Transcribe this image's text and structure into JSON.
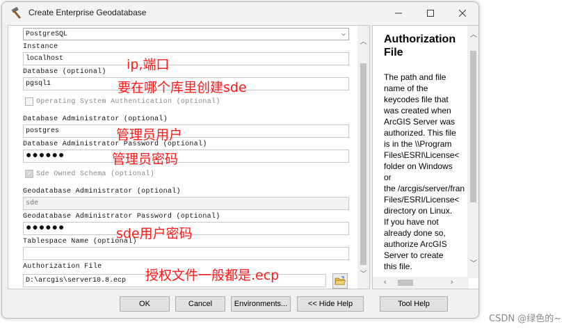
{
  "window": {
    "title": "Create Enterprise Geodatabase"
  },
  "form": {
    "platform_value": "PostgreSQL",
    "instance_label": "Instance",
    "instance_value": "localhost",
    "database_label": "Database (optional)",
    "database_value": "pgsql1",
    "os_auth_label": "Operating System Authentication (optional)",
    "db_admin_label": "Database Administrator (optional)",
    "db_admin_value": "postgres",
    "db_admin_pw_label": "Database Administrator Password (optional)",
    "db_admin_pw_value": "●●●●●●",
    "sde_schema_label": "Sde Owned Schema (optional)",
    "gdb_admin_label": "Geodatabase Administrator (optional)",
    "gdb_admin_value": "sde",
    "gdb_admin_pw_label": "Geodatabase Administrator Password (optional)",
    "gdb_admin_pw_value": "●●●●●●",
    "tablespace_label": "Tablespace Name (optional)",
    "tablespace_value": "",
    "auth_file_label": "Authorization File",
    "auth_file_value": "D:\\arcgis\\server10.8.ecp"
  },
  "annotations": {
    "instance": "ip,端口",
    "database": "要在哪个库里创建sde",
    "db_admin": "管理员用户",
    "db_admin_pw": "管理员密码",
    "gdb_admin_pw": "sde用户密码",
    "auth_file": "授权文件一般都是.ecp"
  },
  "help": {
    "title": "Authorization File",
    "body": "The path and file\nname of the\nkeycodes file that\nwas created when\nArcGIS Server was\nauthorized. This file\nis in the \\\\Program\nFiles\\ESRI\\License<\nfolder on Windows\nor\nthe /arcgis/server/fran\nFiles/ESRI/License<\ndirectory on Linux.\nIf you have not\nalready done so,\nauthorize ArcGIS\nServer to create\nthis file."
  },
  "buttons": {
    "ok": "OK",
    "cancel": "Cancel",
    "environments": "Environments...",
    "hide_help": "<< Hide Help",
    "tool_help": "Tool Help"
  },
  "watermark": "CSDN @绿色的~",
  "icons": {
    "app": "hammer-icon",
    "folder": "open-folder-icon"
  },
  "colors": {
    "annotation": "#ff1a1a",
    "window_bg": "#f0f0f0"
  }
}
